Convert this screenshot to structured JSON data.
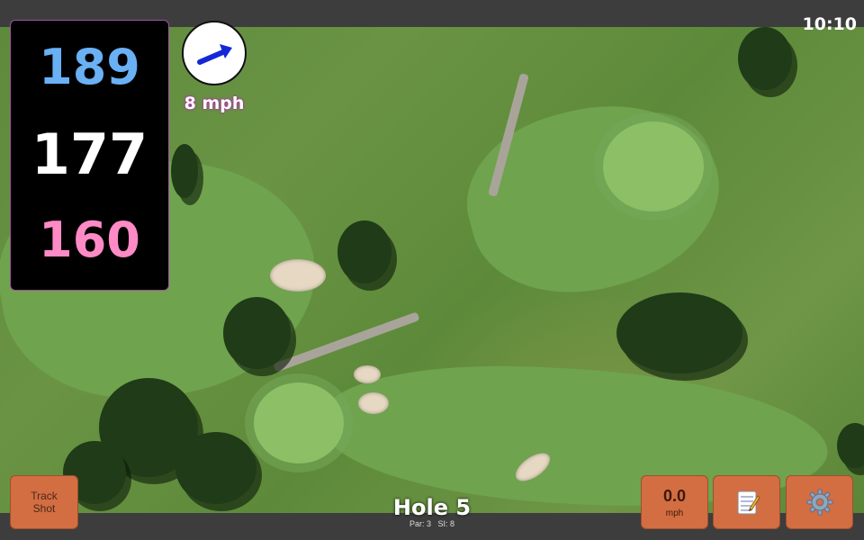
{
  "status": {
    "time": "10:10"
  },
  "distances": {
    "back": "189",
    "middle": "177",
    "front": "160"
  },
  "wind": {
    "speed": "8 mph",
    "icon": "arrow-icon",
    "arrow_color": "#1428d6"
  },
  "hole": {
    "title": "Hole 5",
    "par_label": "Par: 3",
    "si_label": "SI: 8"
  },
  "buttons": {
    "track_line1": "Track",
    "track_line2": "Shot",
    "speed_value": "0.0",
    "speed_unit": "mph",
    "notes_icon": "notepad-icon",
    "settings_icon": "gear-icon"
  },
  "colors": {
    "back_distance": "#6ab0f5",
    "middle_distance": "#ffffff",
    "front_distance": "#ff8ac6",
    "button_bg": "#d36d42"
  }
}
